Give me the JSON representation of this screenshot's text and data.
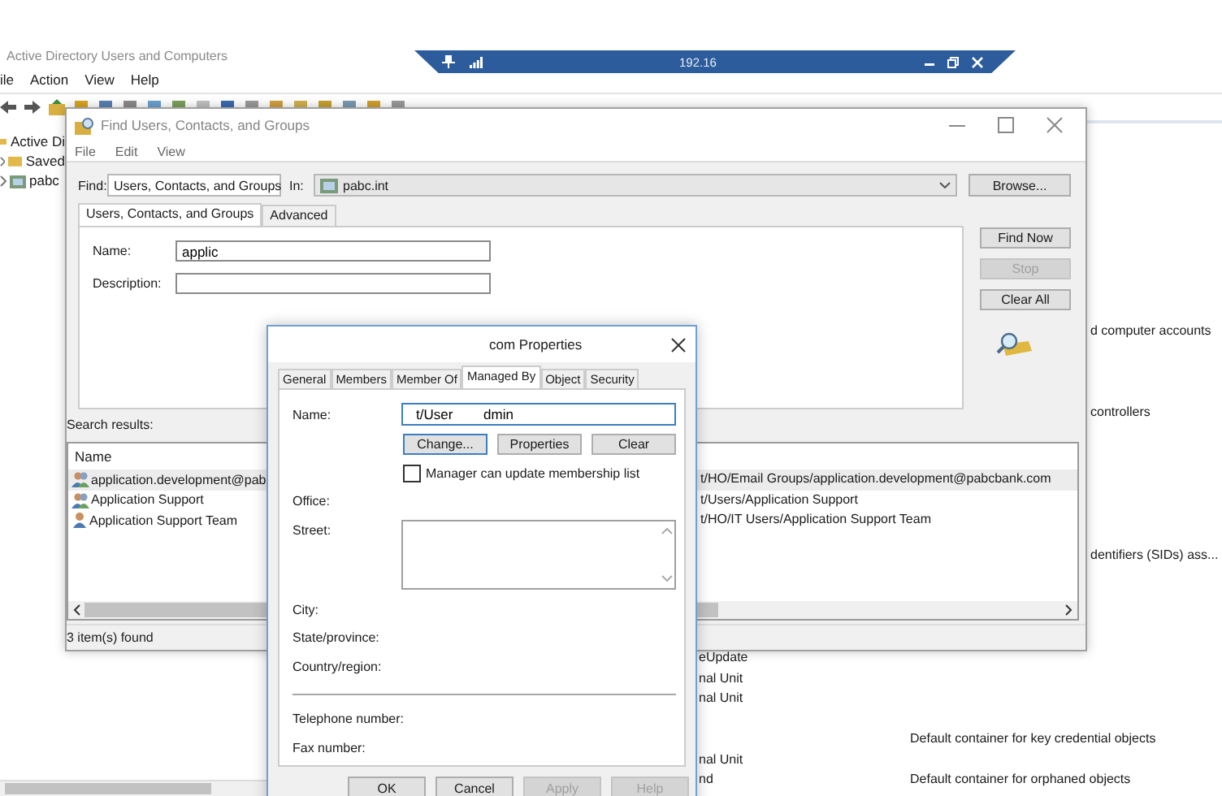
{
  "connection_bar": {
    "host": "192.16"
  },
  "main_window": {
    "title": "Active Directory Users and Computers",
    "menu": [
      "ile",
      "Action",
      "View",
      "Help"
    ],
    "tree": [
      {
        "label": "Active Di",
        "children": [
          {
            "label": "Saved"
          },
          {
            "label": "pabc"
          }
        ]
      }
    ],
    "details_side": [
      "d computer accounts",
      "controllers",
      "dentifiers (SIDs) ass..."
    ],
    "details_rows": [
      {
        "name": "eUpdate"
      },
      {
        "name": "nal Unit"
      },
      {
        "name": "nal Unit"
      },
      {
        "description": "Default container for key credential objects"
      },
      {
        "name": "nal Unit"
      },
      {
        "name": "nd",
        "description": "Default container for orphaned objects"
      }
    ]
  },
  "find_dialog": {
    "title": "Find Users, Contacts, and Groups",
    "menu": [
      "File",
      "Edit",
      "View"
    ],
    "find_label": "Find:",
    "find_value": "Users, Contacts, and Groups",
    "in_label": "In:",
    "in_value": "pabc.int",
    "browse": "Browse...",
    "tabs": [
      {
        "label": "Users, Contacts, and Groups",
        "selected": true
      },
      {
        "label": "Advanced",
        "selected": false
      }
    ],
    "fields": [
      {
        "label": "Name:",
        "value": "applic"
      },
      {
        "label": "Description:"
      }
    ],
    "buttons": [
      {
        "label": "Find Now",
        "disabled": false
      },
      {
        "label": "Stop",
        "disabled": true
      },
      {
        "label": "Clear All",
        "disabled": false
      }
    ],
    "results_label": "Search results:",
    "results": {
      "columns": [
        "Name"
      ],
      "rows": [
        {
          "kind": "group",
          "name": "application.development@pab",
          "column_2": "t/HO/Email Groups/application.development@pabcbank.com",
          "selected": true
        },
        {
          "kind": "group",
          "name": "Application Support",
          "column_2": "t/Users/Application Support",
          "selected": false
        },
        {
          "kind": "user",
          "name": "Application Support Team",
          "column_2": "t/HO/IT Users/Application Support Team",
          "selected": false
        }
      ]
    },
    "status": "3 item(s) found"
  },
  "properties_dialog": {
    "title": "com Properties",
    "tabs": [
      {
        "label": "General",
        "selected": false
      },
      {
        "label": "Members",
        "selected": false
      },
      {
        "label": "Member Of",
        "selected": false
      },
      {
        "label": "Managed By",
        "selected": true
      },
      {
        "label": "Object",
        "selected": false
      },
      {
        "label": "Security",
        "selected": false
      }
    ],
    "name_label": "Name:",
    "name_value": "t/User        dmin",
    "name_buttons": [
      "Change...",
      "Properties",
      "Clear"
    ],
    "manager_can_update": {
      "label": "Manager can update membership list",
      "checked": false
    },
    "office_label": "Office:",
    "street_label": "Street:",
    "city_label": "City:",
    "state_label": "State/province:",
    "country_label": "Country/region:",
    "telephone_label": "Telephone number:",
    "fax_label": "Fax number:",
    "buttons": [
      {
        "label": "OK",
        "disabled": false
      },
      {
        "label": "Cancel",
        "disabled": false
      },
      {
        "label": "Apply",
        "disabled": true
      },
      {
        "label": "Help",
        "disabled": true
      }
    ]
  }
}
